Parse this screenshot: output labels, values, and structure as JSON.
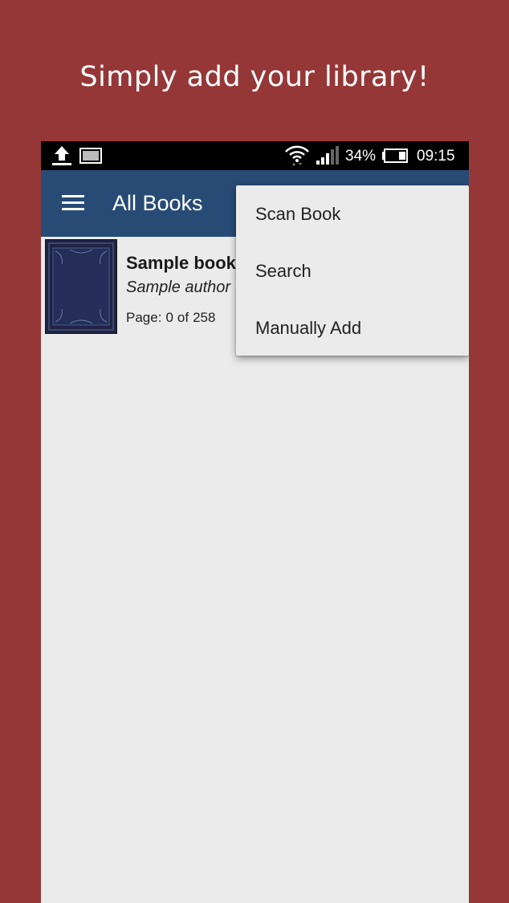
{
  "promo": {
    "headline": "Simply add your library!"
  },
  "status_bar": {
    "battery_percent": "34%",
    "time": "09:15",
    "icons": [
      "upload-icon",
      "image-icon",
      "wifi-icon",
      "signal-icon",
      "battery-icon"
    ]
  },
  "app_bar": {
    "title": "All Books",
    "menu_icon": "hamburger-menu-icon"
  },
  "books": [
    {
      "title": "Sample book",
      "author": "Sample author",
      "page_label": "Page:",
      "current_page": "0",
      "of_label": "of",
      "total_pages": "258"
    }
  ],
  "overflow_menu": {
    "items": [
      {
        "label": "Scan Book"
      },
      {
        "label": "Search"
      },
      {
        "label": "Manually Add"
      }
    ]
  },
  "colors": {
    "background": "#953737",
    "app_bar": "#284b75",
    "content": "#ebebeb",
    "book_cover": "#1c2241"
  }
}
